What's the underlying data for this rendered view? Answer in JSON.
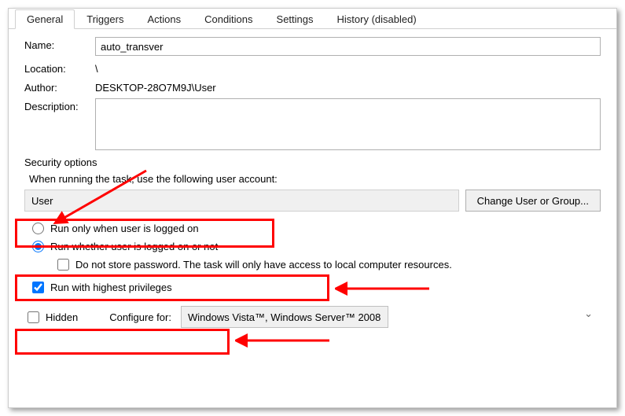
{
  "tabs": {
    "general": "General",
    "triggers": "Triggers",
    "actions": "Actions",
    "conditions": "Conditions",
    "settings": "Settings",
    "history": "History (disabled)"
  },
  "labels": {
    "name": "Name:",
    "location": "Location:",
    "author": "Author:",
    "description": "Description:",
    "security_options": "Security options",
    "when_running": "When running the task, use the following user account:",
    "change_user": "Change User or Group...",
    "run_logged_on": "Run only when user is logged on",
    "run_whether": "Run whether user is logged on or not",
    "do_not_store": "Do not store password.  The task will only have access to local computer resources.",
    "highest_priv": "Run with highest privileges",
    "hidden": "Hidden",
    "configure_for": "Configure for:"
  },
  "values": {
    "name": "auto_transver",
    "location": "\\",
    "author": "DESKTOP-28O7M9J\\User",
    "description": "",
    "user_account": "User",
    "configure_for": "Windows Vista™, Windows Server™ 2008"
  }
}
